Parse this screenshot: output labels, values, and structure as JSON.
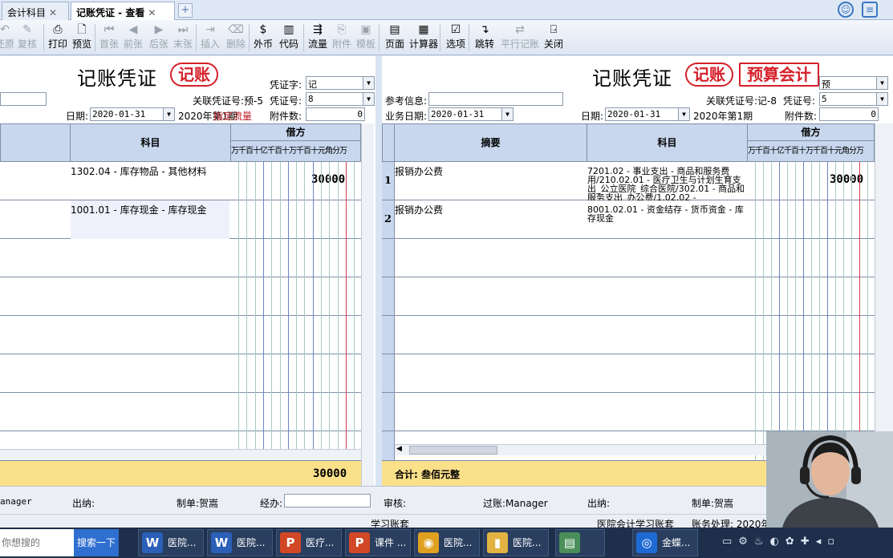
{
  "tabs": [
    {
      "label": "会计科目",
      "active": false
    },
    {
      "label": "记账凭证 - 查看",
      "active": true
    }
  ],
  "tab_close": "✕",
  "tab_add": "+",
  "toolbar": [
    {
      "label": "还原",
      "icon": "undo-icon",
      "disabled": true
    },
    {
      "label": "复核",
      "icon": "check-icon",
      "disabled": true
    },
    {
      "label": "打印",
      "icon": "print-icon",
      "disabled": false
    },
    {
      "label": "预览",
      "icon": "preview-icon",
      "disabled": false
    },
    {
      "label": "首张",
      "icon": "first-icon",
      "disabled": true
    },
    {
      "label": "前张",
      "icon": "prev-icon",
      "disabled": true
    },
    {
      "label": "后张",
      "icon": "next-icon",
      "disabled": true
    },
    {
      "label": "末张",
      "icon": "last-icon",
      "disabled": true
    },
    {
      "label": "插入",
      "icon": "insert-icon",
      "disabled": true
    },
    {
      "label": "删除",
      "icon": "delete-icon",
      "disabled": true
    },
    {
      "label": "外币",
      "icon": "currency-icon",
      "disabled": false
    },
    {
      "label": "代码",
      "icon": "code-icon",
      "disabled": false
    },
    {
      "label": "流量",
      "icon": "flow-icon",
      "disabled": false
    },
    {
      "label": "附件",
      "icon": "attachment-icon",
      "disabled": true
    },
    {
      "label": "模板",
      "icon": "template-icon",
      "disabled": true
    },
    {
      "label": "页面",
      "icon": "page-icon",
      "disabled": false
    },
    {
      "label": "计算器",
      "icon": "calculator-icon",
      "disabled": false
    },
    {
      "label": "选项",
      "icon": "options-icon",
      "disabled": false
    },
    {
      "label": "跳转",
      "icon": "jump-icon",
      "disabled": false
    },
    {
      "label": "平行记账",
      "icon": "parallel-icon",
      "disabled": true
    },
    {
      "label": "关闭",
      "icon": "close-door-icon",
      "disabled": false
    }
  ],
  "left": {
    "title": "记账凭证",
    "stamp": "记账",
    "voucher_type_label": "凭证字:",
    "voucher_type": "记",
    "related_no": "关联凭证号:预-5",
    "voucher_no_label": "凭证号:",
    "voucher_no": "8",
    "attach_label": "附件数:",
    "attach_value": "0",
    "date_label": "日期:",
    "date": "2020-01-31",
    "period": "2020年第1期",
    "hint": "指定流量",
    "headers": {
      "subject": "科目",
      "debit": "借方",
      "digits": "万千百十亿千百十万千百十元角分万"
    },
    "rows": [
      {
        "subject": "1302.04 - 库存物品 - 其他材料",
        "debit": "30000"
      },
      {
        "subject": "1001.01 - 库存现金 - 库存现金",
        "debit": ""
      }
    ],
    "total": "30000"
  },
  "right": {
    "title": "记账凭证",
    "stamp": "记账",
    "stamp2": "预算会计",
    "voucher_type": "预",
    "ref_label": "参考信息:",
    "related_no": "关联凭证号:记-8",
    "voucher_no_label": "凭证号:",
    "voucher_no": "5",
    "attach_label": "附件数:",
    "attach_value": "0",
    "biz_date_label": "业务日期:",
    "biz_date": "2020-01-31",
    "date_label": "日期:",
    "date": "2020-01-31",
    "period": "2020年第1期",
    "headers": {
      "summary": "摘要",
      "subject": "科目",
      "debit": "借方",
      "digits": "万千百十亿千百十万千百十元角分万"
    },
    "rows": [
      {
        "no": "1",
        "summary": "报销办公费",
        "subject": "7201.02 - 事业支出 - 商品和服务费用/210.02.01 - 医疗卫生与计划生育支出_公立医院_综合医院/302.01 - 商品和服务支出_办公费/1.02.02 -",
        "debit": "30000"
      },
      {
        "no": "2",
        "summary": "报销办公费",
        "subject": "8001.02.01 - 资金结存 - 货币资金 - 库存现金",
        "debit": ""
      }
    ],
    "total_text": "合计: 叁佰元整"
  },
  "footer": {
    "left_cashier": "anager",
    "cashier": "出纳:",
    "maker": "制单:贺嵩",
    "handler": "经办:",
    "auditor": "审核:",
    "poster": "过账:Manager",
    "cashier2": "出纳:",
    "maker2": "制单:贺嵩",
    "book_left": "学习账套",
    "book_right": "医院会计学习账套",
    "processing": "账务处理: 2020年"
  },
  "taskbar": {
    "search_placeholder": "你想搜的",
    "search_btn": "搜索一下",
    "apps": [
      {
        "label": "医院...",
        "icon": "W",
        "color": "#2b5fb8"
      },
      {
        "label": "医院...",
        "icon": "W",
        "color": "#2b5fb8"
      },
      {
        "label": "医疗...",
        "icon": "P",
        "color": "#d24726"
      },
      {
        "label": "课件 ...",
        "icon": "P",
        "color": "#d24726"
      },
      {
        "label": "医院...",
        "icon": "◉",
        "color": "#e0a020"
      },
      {
        "label": "医院...",
        "icon": "▮",
        "color": "#e3b341"
      },
      {
        "label": "",
        "icon": "▤",
        "color": "#4a8f5a"
      },
      {
        "label": "金蝶...",
        "icon": "◎",
        "color": "#1e6ad4"
      }
    ]
  }
}
